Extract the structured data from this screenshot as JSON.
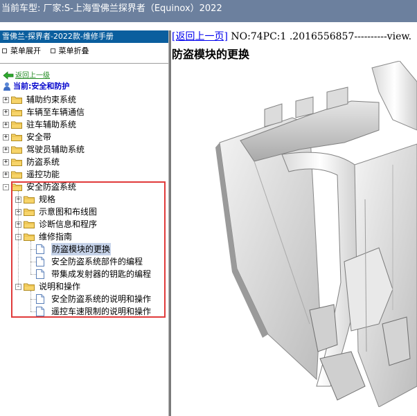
{
  "titlebar": {
    "text": "当前车型:  厂家:S-上海雪佛兰探界者（Equinox）2022"
  },
  "sidebar": {
    "header": "雪佛兰-探界者-2022款-维修手册",
    "expand_label": "菜单展开",
    "collapse_label": "菜单折叠",
    "back_label": "返回上一级",
    "current_label": "当前:安全和防护"
  },
  "tree": [
    {
      "label": "辅助约束系统",
      "type": "folder",
      "level": 0,
      "expander": "+"
    },
    {
      "label": "车辆至车辆通信",
      "type": "folder",
      "level": 0,
      "expander": "+"
    },
    {
      "label": "驻车辅助系统",
      "type": "folder",
      "level": 0,
      "expander": "+"
    },
    {
      "label": "安全带",
      "type": "folder",
      "level": 0,
      "expander": "+"
    },
    {
      "label": "驾驶员辅助系统",
      "type": "folder",
      "level": 0,
      "expander": "+"
    },
    {
      "label": "防盗系统",
      "type": "folder",
      "level": 0,
      "expander": "+"
    },
    {
      "label": "遥控功能",
      "type": "folder",
      "level": 0,
      "expander": "+"
    },
    {
      "label": "安全防盗系统",
      "type": "folder",
      "level": 0,
      "expander": "-"
    },
    {
      "label": "规格",
      "type": "folder",
      "level": 1,
      "expander": "+"
    },
    {
      "label": "示意图和布线图",
      "type": "folder",
      "level": 1,
      "expander": "+"
    },
    {
      "label": "诊断信息和程序",
      "type": "folder",
      "level": 1,
      "expander": "+"
    },
    {
      "label": "维修指南",
      "type": "folder",
      "level": 1,
      "expander": "-"
    },
    {
      "label": "防盗模块的更换",
      "type": "doc",
      "level": 2,
      "selected": true
    },
    {
      "label": "安全防盗系统部件的编程",
      "type": "doc",
      "level": 2
    },
    {
      "label": "带集成发射器的钥匙的编程",
      "type": "doc",
      "level": 2
    },
    {
      "label": "说明和操作",
      "type": "folder",
      "level": 1,
      "expander": "-"
    },
    {
      "label": "安全防盗系统的说明和操作",
      "type": "doc",
      "level": 2
    },
    {
      "label": "遥控车速限制的说明和操作",
      "type": "doc",
      "level": 2
    }
  ],
  "content": {
    "back_link": "[返回上一页]",
    "doc_id": " NO:74PC:1 .2016556857----------view.",
    "title": "防盗模块的更换"
  },
  "colors": {
    "titlebar": "#6c809e",
    "header": "#0a5e9e",
    "highlight": "#e03a3a",
    "link": "#0000ee"
  }
}
